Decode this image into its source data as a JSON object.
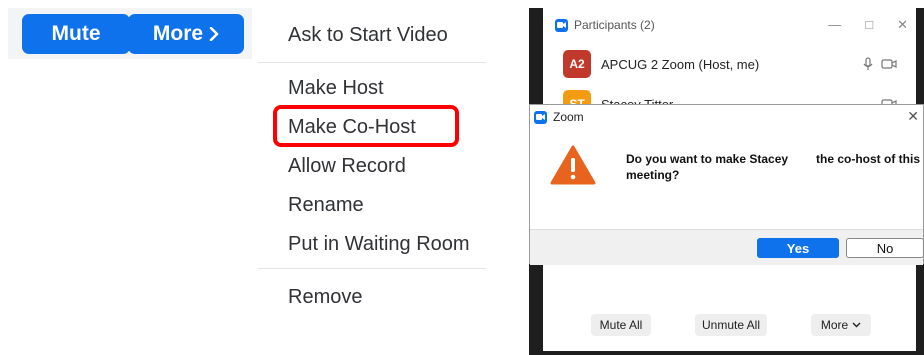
{
  "toolbar": {
    "mute_label": "Mute",
    "more_label": "More",
    "accent": "#0e72ed"
  },
  "menu": {
    "items": [
      "Ask to Start Video",
      "Make Host",
      "Make Co-Host",
      "Allow Record",
      "Rename",
      "Put in Waiting Room",
      "Remove"
    ],
    "highlighted": "Make Co-Host",
    "highlight_color": "#ff0000"
  },
  "participants_window": {
    "title": "Participants (2)",
    "rows": [
      {
        "initials": "A2",
        "name": "APCUG 2 Zoom (Host, me)",
        "color": "#c0392b"
      },
      {
        "initials": "ST",
        "name": "Stacey Titter",
        "color": "#f39c12"
      }
    ],
    "footer": {
      "mute_all": "Mute All",
      "unmute_all": "Unmute All",
      "more": "More"
    }
  },
  "dialog": {
    "title": "Zoom",
    "message_part1": "Do you want to make Stacey",
    "message_part2": "the co-host of this",
    "message_part3": "meeting?",
    "yes_label": "Yes",
    "no_label": "No",
    "warning_color": "#e8641e"
  }
}
